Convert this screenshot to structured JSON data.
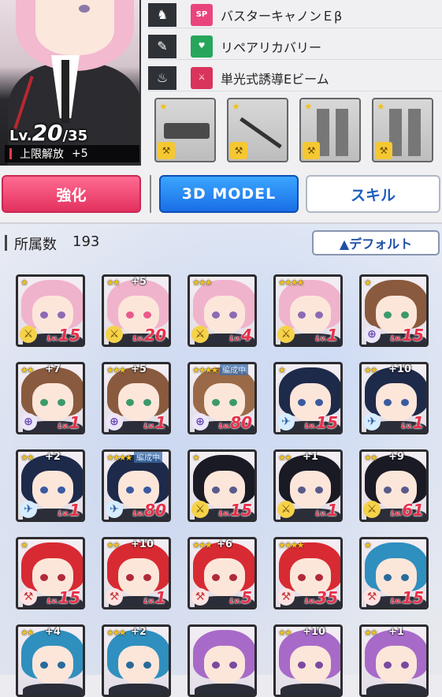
{
  "character": {
    "level_prefix": "Lv.",
    "level": "20",
    "max_level": "/35",
    "limit_label": "上限解放",
    "limit_value": "+5"
  },
  "skills": [
    {
      "slot_icon": "silhouette-icon",
      "badge": "SP",
      "badge_color": "#e9457c",
      "name": "バスターキャノンＥβ"
    },
    {
      "slot_icon": "wrench-icon",
      "badge": "♥",
      "badge_color": "#26a65b",
      "name": "リペアリカバリー"
    },
    {
      "slot_icon": "boot-icon",
      "badge": "⚔",
      "badge_color": "#d9345c",
      "name": "単光式誘導Eビーム"
    }
  ],
  "equipment": [
    {
      "name": "cannon-equipment",
      "stars": "★"
    },
    {
      "name": "rod-equipment",
      "stars": "★"
    },
    {
      "name": "arm-equipment",
      "stars": "★"
    },
    {
      "name": "leg-equipment",
      "stars": "★"
    }
  ],
  "buttons": {
    "power": "強化",
    "model": "3D MODEL",
    "skill": "スキル"
  },
  "roster": {
    "label": "所属数",
    "count": "193",
    "sort": "▲デフォルト"
  },
  "cards": [
    {
      "stars": "★",
      "plus": "",
      "lv": "15",
      "hair": "#f0b3cc",
      "eye": "#8d6ab5",
      "icon": "sword",
      "badge": ""
    },
    {
      "stars": "★★",
      "plus": "+5",
      "lv": "20",
      "hair": "#f0b3cc",
      "eye": "#ea5a8c",
      "icon": "sword",
      "badge": ""
    },
    {
      "stars": "★★★",
      "plus": "",
      "lv": "4",
      "hair": "#f0b3cc",
      "eye": "#8d6ab5",
      "icon": "sword",
      "badge": ""
    },
    {
      "stars": "★★★★",
      "plus": "",
      "lv": "1",
      "hair": "#f0b3cc",
      "eye": "#8d6ab5",
      "icon": "sword",
      "badge": ""
    },
    {
      "stars": "★",
      "plus": "",
      "lv": "15",
      "hair": "#8a5a3e",
      "eye": "#3c9a6a",
      "icon": "target",
      "badge": ""
    },
    {
      "stars": "★★",
      "plus": "+7",
      "lv": "1",
      "hair": "#8a5a3e",
      "eye": "#3c9a6a",
      "icon": "target",
      "badge": ""
    },
    {
      "stars": "★★★",
      "plus": "+5",
      "lv": "1",
      "hair": "#8a5a3e",
      "eye": "#3c9a6a",
      "icon": "target",
      "badge": ""
    },
    {
      "stars": "★★★★",
      "plus": "",
      "lv": "80",
      "hair": "#9a6a48",
      "eye": "#3c9a6a",
      "icon": "target",
      "badge": "編成中"
    },
    {
      "stars": "★",
      "plus": "",
      "lv": "15",
      "hair": "#1e2a4a",
      "eye": "#3a5aa0",
      "icon": "gun",
      "badge": ""
    },
    {
      "stars": "★★",
      "plus": "+10",
      "lv": "1",
      "hair": "#1e2a4a",
      "eye": "#3a5aa0",
      "icon": "gun",
      "badge": ""
    },
    {
      "stars": "★★",
      "plus": "+2",
      "lv": "1",
      "hair": "#1e2a4a",
      "eye": "#3a5aa0",
      "icon": "gun",
      "badge": ""
    },
    {
      "stars": "★★★★",
      "plus": "",
      "lv": "80",
      "hair": "#1e2a4a",
      "eye": "#3a5aa0",
      "icon": "gun",
      "badge": "編成中"
    },
    {
      "stars": "★",
      "plus": "",
      "lv": "15",
      "hair": "#1a1a24",
      "eye": "#5a5a8a",
      "icon": "sword",
      "badge": ""
    },
    {
      "stars": "★★",
      "plus": "+1",
      "lv": "1",
      "hair": "#1a1a24",
      "eye": "#5a5a8a",
      "icon": "sword",
      "badge": ""
    },
    {
      "stars": "★★",
      "plus": "+9",
      "lv": "61",
      "hair": "#1a1a24",
      "eye": "#5a5a8a",
      "icon": "sword",
      "badge": ""
    },
    {
      "stars": "★",
      "plus": "",
      "lv": "15",
      "hair": "#d82a32",
      "eye": "#b02a3a",
      "icon": "hammer",
      "badge": ""
    },
    {
      "stars": "★★",
      "plus": "+10",
      "lv": "1",
      "hair": "#d82a32",
      "eye": "#b02a3a",
      "icon": "hammer",
      "badge": ""
    },
    {
      "stars": "★★★",
      "plus": "+6",
      "lv": "5",
      "hair": "#d82a32",
      "eye": "#b02a3a",
      "icon": "hammer",
      "badge": ""
    },
    {
      "stars": "★★★★",
      "plus": "",
      "lv": "35",
      "hair": "#d82a32",
      "eye": "#b02a3a",
      "icon": "hammer",
      "badge": ""
    },
    {
      "stars": "★",
      "plus": "",
      "lv": "15",
      "hair": "#2f8fbf",
      "eye": "#2a6a9a",
      "icon": "hammer",
      "badge": ""
    },
    {
      "stars": "★★",
      "plus": "+4",
      "lv": "",
      "hair": "#2f8fbf",
      "eye": "#2a6a9a",
      "icon": "",
      "badge": ""
    },
    {
      "stars": "★★★",
      "plus": "+2",
      "lv": "",
      "hair": "#2f8fbf",
      "eye": "#2a6a9a",
      "icon": "",
      "badge": ""
    },
    {
      "stars": "",
      "plus": "",
      "lv": "",
      "hair": "#a86ac8",
      "eye": "#7a4aa0",
      "icon": "",
      "badge": ""
    },
    {
      "stars": "★★",
      "plus": "+10",
      "lv": "",
      "hair": "#a86ac8",
      "eye": "#7a4aa0",
      "icon": "",
      "badge": ""
    },
    {
      "stars": "★★",
      "plus": "+1",
      "lv": "",
      "hair": "#a86ac8",
      "eye": "#7a4aa0",
      "icon": "",
      "badge": ""
    }
  ]
}
